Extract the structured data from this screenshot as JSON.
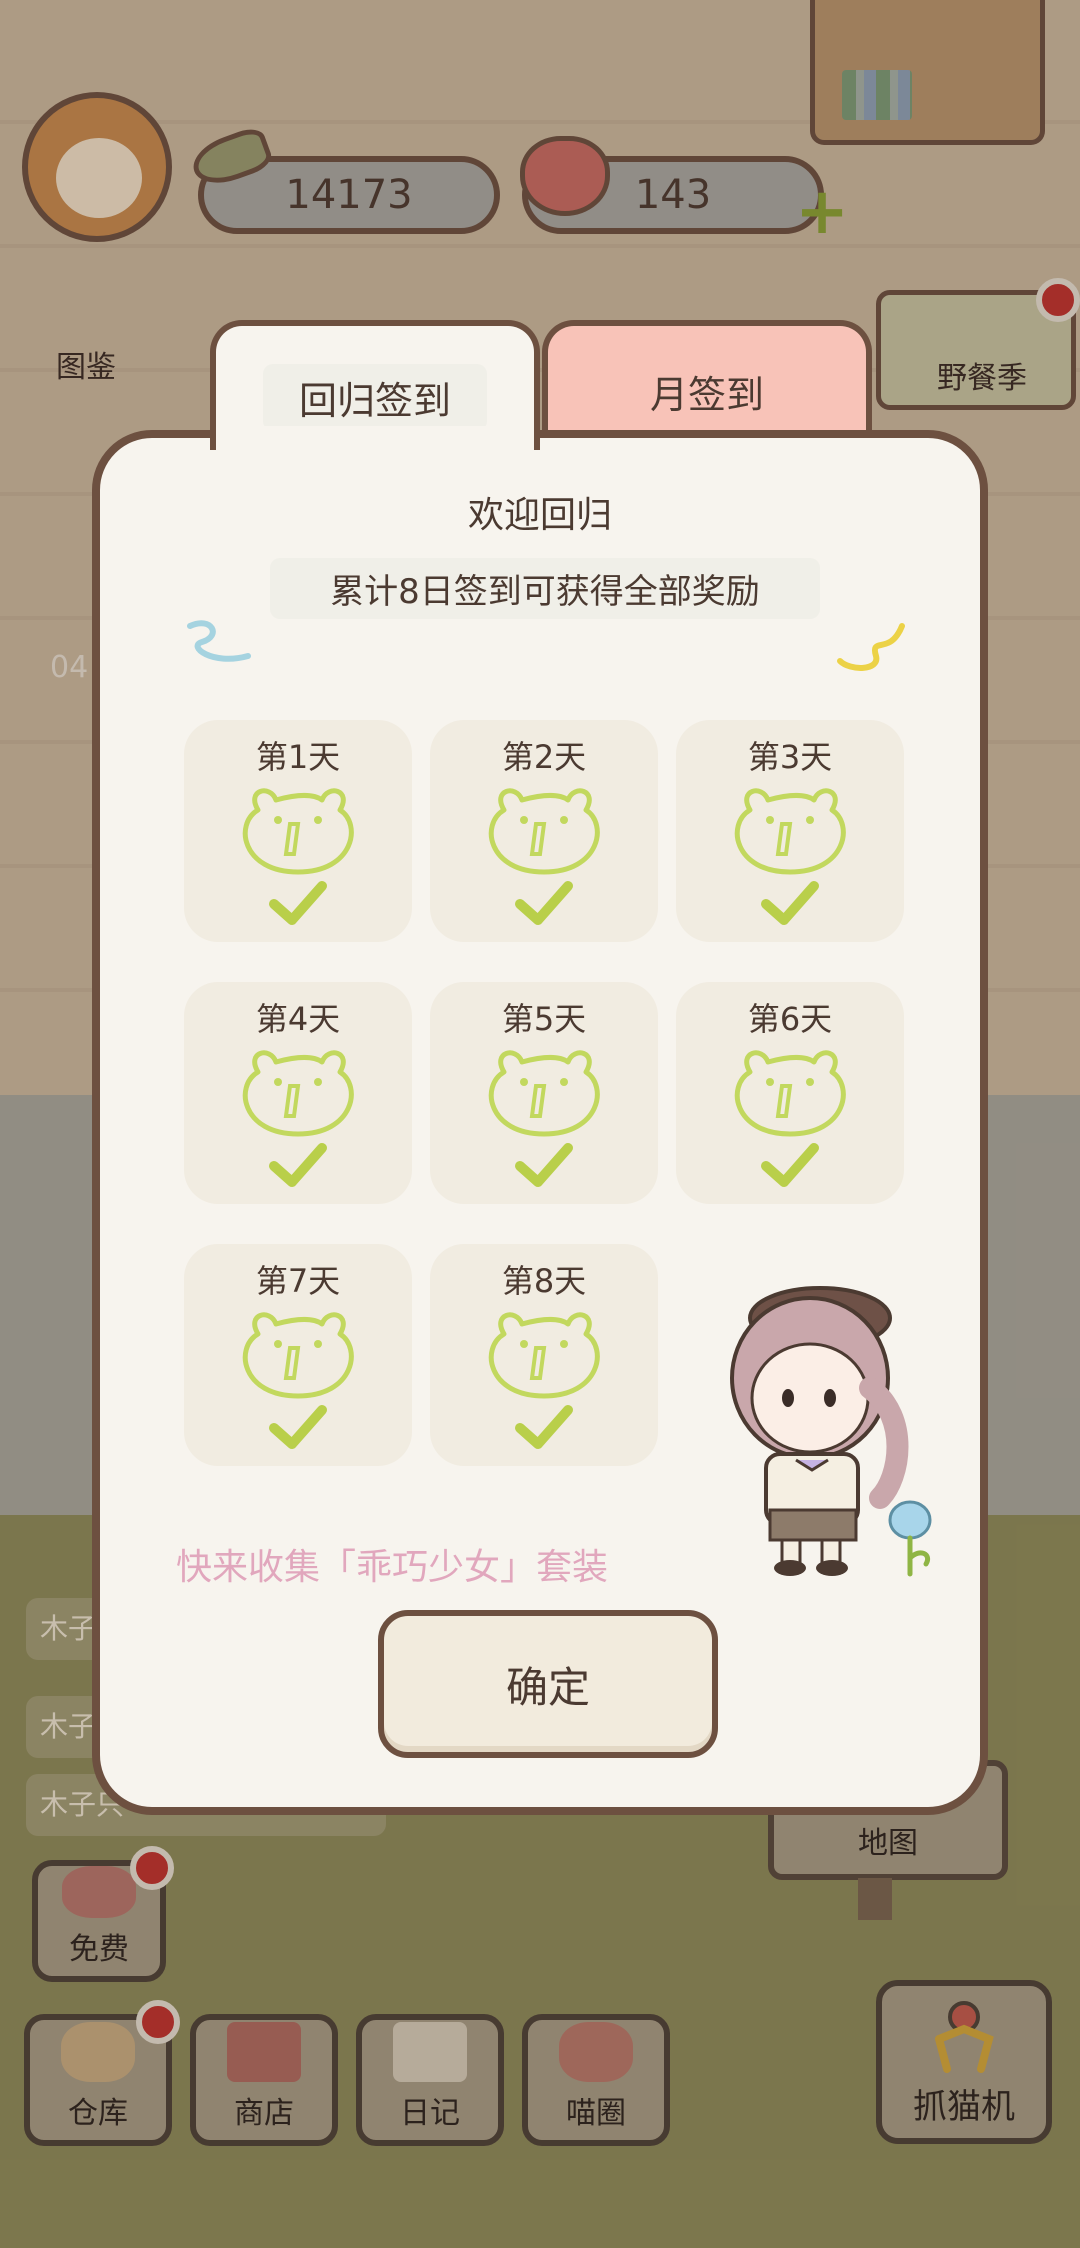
{
  "hud": {
    "fish_count": "14173",
    "heart_count": "143"
  },
  "side_menu": {
    "catalog_label": "图鉴",
    "event_label": "野餐季",
    "counter_text": "04"
  },
  "mail_rows": [
    "木子",
    "木子",
    "木子只"
  ],
  "bottom_nav": {
    "free_label": "免费",
    "items": [
      {
        "label": "仓库",
        "icon": "warehouse-icon"
      },
      {
        "label": "商店",
        "icon": "shop-icon"
      },
      {
        "label": "日记",
        "icon": "diary-icon"
      },
      {
        "label": "喵圈",
        "icon": "cat-planet-icon"
      }
    ],
    "map_label": "地图",
    "claw_label": "抓猫机"
  },
  "modal": {
    "tabs": [
      {
        "label": "回归签到",
        "active": true
      },
      {
        "label": "月签到",
        "active": false
      }
    ],
    "welcome": "欢迎回归",
    "subtitle": "累计8日签到可获得全部奖励",
    "days": [
      {
        "label": "第1天",
        "claimed": true
      },
      {
        "label": "第2天",
        "claimed": true
      },
      {
        "label": "第3天",
        "claimed": true
      },
      {
        "label": "第4天",
        "claimed": true
      },
      {
        "label": "第5天",
        "claimed": true
      },
      {
        "label": "第6天",
        "claimed": true
      },
      {
        "label": "第7天",
        "claimed": true
      },
      {
        "label": "第8天",
        "claimed": true
      }
    ],
    "promo": "快来收集「乖巧少女」套装",
    "confirm_label": "确定"
  },
  "colors": {
    "accent_green": "#b9cf4a",
    "tab_pink": "#f8c3b8",
    "border_brown": "#6d5040",
    "promo_pink": "#e1a7bd"
  }
}
